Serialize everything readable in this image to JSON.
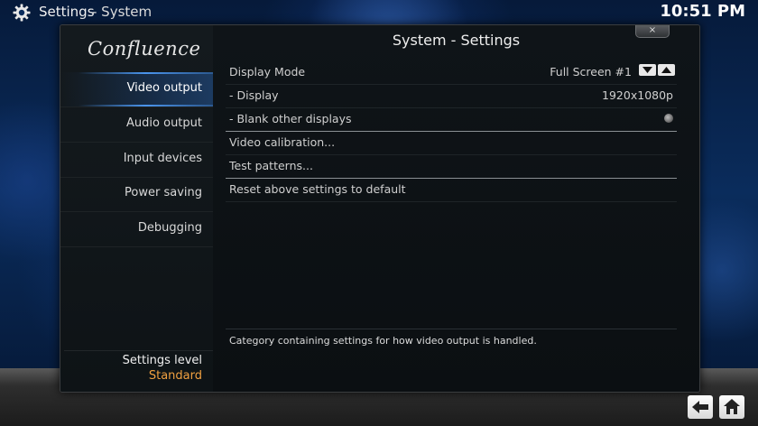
{
  "header": {
    "title": "Settings",
    "subtitle": "- System",
    "clock": "10:51 PM"
  },
  "sidebar": {
    "logo": "Confluence",
    "items": [
      {
        "label": "Video output",
        "active": true
      },
      {
        "label": "Audio output",
        "active": false
      },
      {
        "label": "Input devices",
        "active": false
      },
      {
        "label": "Power saving",
        "active": false
      },
      {
        "label": "Debugging",
        "active": false
      }
    ],
    "settings_level_label": "Settings level",
    "settings_level_value": "Standard"
  },
  "content": {
    "title": "System - Settings",
    "close_label": "×",
    "rows": [
      {
        "label": "Display Mode",
        "value": "Full Screen #1",
        "control": "spinner"
      },
      {
        "label": "- Display",
        "value": "1920x1080p",
        "control": "value"
      },
      {
        "label": "- Blank other displays",
        "value": "",
        "control": "radio"
      },
      {
        "label": "Video calibration...",
        "value": "",
        "control": "none"
      },
      {
        "label": "Test patterns...",
        "value": "",
        "control": "none"
      },
      {
        "label": "Reset above settings to default",
        "value": "",
        "control": "none"
      }
    ],
    "description": "Category containing settings for how video output is handled."
  },
  "footer": {
    "back_icon": "back-arrow-icon",
    "home_icon": "home-icon"
  },
  "colors": {
    "accent_orange": "#f0a040",
    "highlight_blue": "#50a0ff",
    "panel_bg": "#0d1114"
  }
}
